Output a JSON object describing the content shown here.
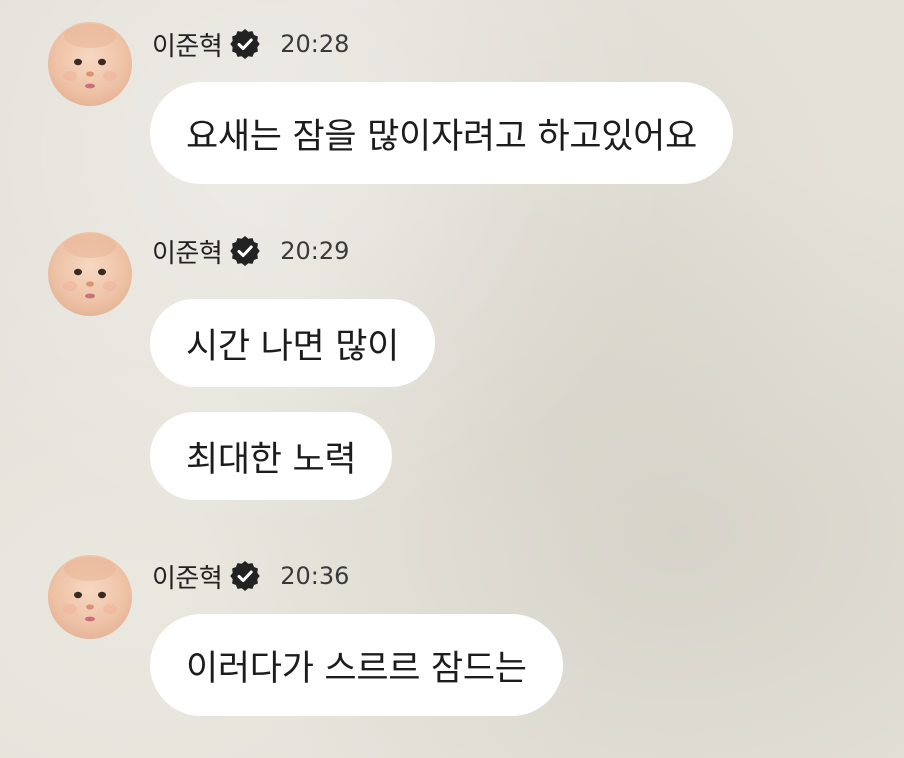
{
  "chat": {
    "groups": [
      {
        "sender": "이준혁",
        "time": "20:28",
        "messages": [
          "요새는 잠을 많이자려고 하고있어요"
        ]
      },
      {
        "sender": "이준혁",
        "time": "20:29",
        "messages": [
          "시간 나면 많이",
          "최대한 노력"
        ]
      },
      {
        "sender": "이준혁",
        "time": "20:36",
        "messages": [
          "이러다가 스르르 잠드는"
        ]
      }
    ]
  },
  "icons": {
    "verified": "verified-badge-icon",
    "avatar": "baby-face-avatar"
  },
  "colors": {
    "background": "#e4e1d9",
    "bubble": "#ffffff",
    "text": "#1c1c1c",
    "badge": "#222222"
  }
}
